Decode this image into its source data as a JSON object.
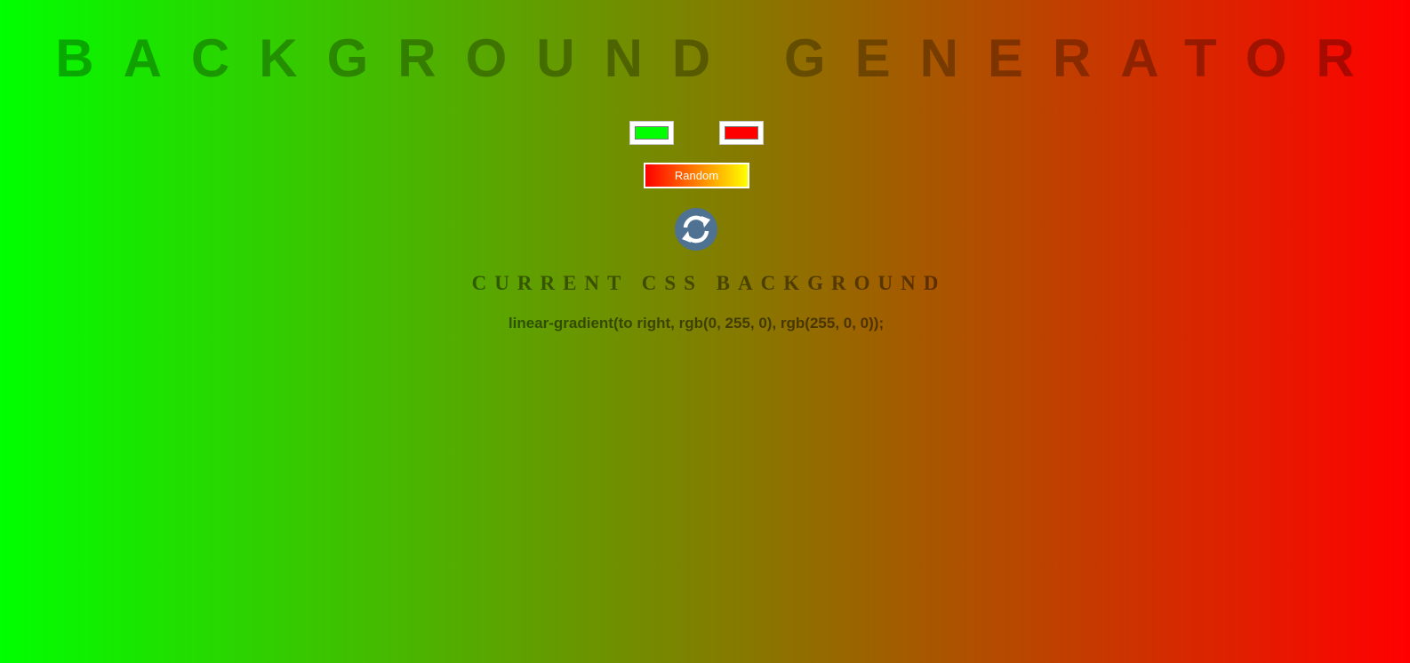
{
  "page": {
    "title": "BACKGROUND GENERATOR",
    "subtitle": "CURRENT CSS BACKGROUND",
    "css_output": "linear-gradient(to right, rgb(0, 255, 0), rgb(255, 0, 0));"
  },
  "background": {
    "direction": "to right",
    "color1": "#00ff00",
    "color2": "#ff0000"
  },
  "controls": {
    "color1_value": "#00ff00",
    "color2_value": "#ff0000",
    "random_label": "Random",
    "random_gradient": [
      "#ff0000",
      "#ffff00"
    ],
    "refresh_icon": "refresh-icon",
    "refresh_color": "#4f7192"
  }
}
